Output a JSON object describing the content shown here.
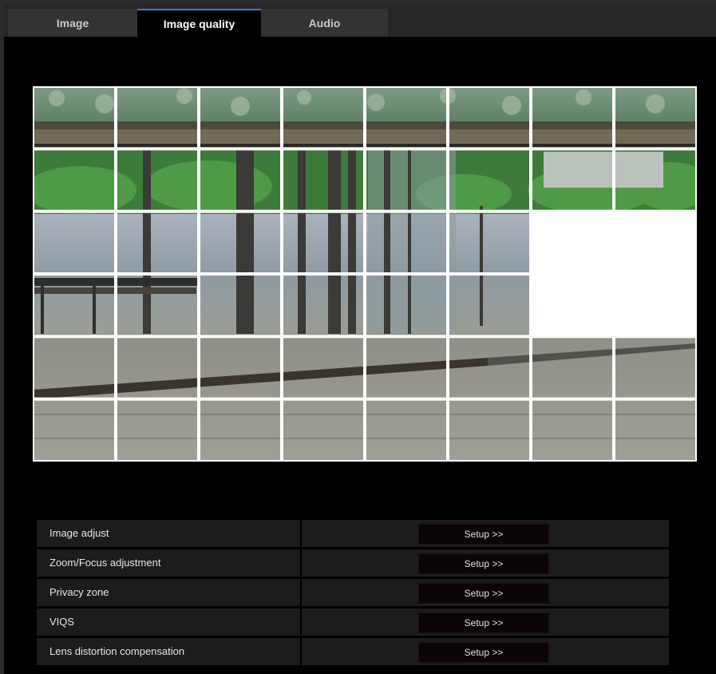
{
  "tabs": [
    {
      "label": "Image",
      "active": false
    },
    {
      "label": "Image quality",
      "active": true
    },
    {
      "label": "Audio",
      "active": false
    }
  ],
  "settings": [
    {
      "label": "Image adjust",
      "button": "Setup >>"
    },
    {
      "label": "Zoom/Focus adjustment",
      "button": "Setup >>"
    },
    {
      "label": "Privacy zone",
      "button": "Setup >>"
    },
    {
      "label": "VIQS",
      "button": "Setup >>"
    },
    {
      "label": "Lens distortion compensation",
      "button": "Setup >>"
    }
  ],
  "privacy_grid": {
    "columns": 8,
    "rows": 6,
    "masked_cells": [
      [
        2,
        6
      ],
      [
        2,
        7
      ],
      [
        3,
        6
      ],
      [
        3,
        7
      ]
    ]
  },
  "colors": {
    "accent": "#3d7fd0",
    "background": "#000000",
    "mask": "#ffffff"
  }
}
